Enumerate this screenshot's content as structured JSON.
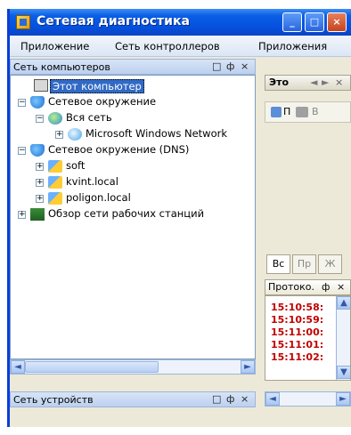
{
  "title": "Сетевая диагностика",
  "title_buttons": {
    "minimize": "_",
    "maximize": "□",
    "close": "×"
  },
  "menu": [
    "Приложение",
    "Сеть контроллеров",
    "Приложения"
  ],
  "left_panel": {
    "title": "Сеть компьютеров",
    "controls": [
      "□",
      "ф",
      "×"
    ],
    "tree": [
      {
        "label": "Этот компьютер",
        "icon": "computer-icon",
        "selected": true
      },
      {
        "label": "Сетевое окружение",
        "icon": "network-places-icon",
        "expanded": true
      },
      {
        "label": "Вся сеть",
        "icon": "globe-icon",
        "expanded": true
      },
      {
        "label": "Microsoft Windows Network",
        "icon": "windows-network-icon"
      },
      {
        "label": "Сетевое окружение (DNS)",
        "icon": "network-places-icon",
        "expanded": true
      },
      {
        "label": "soft",
        "icon": "domain-icon"
      },
      {
        "label": "kvint.local",
        "icon": "domain-icon"
      },
      {
        "label": "poligon.local",
        "icon": "domain-icon"
      },
      {
        "label": "Обзор сети рабочих станций",
        "icon": "workstations-icon"
      }
    ]
  },
  "devices_panel": {
    "title": "Сеть устройств",
    "controls": [
      "□",
      "ф",
      "×"
    ]
  },
  "right_panel": {
    "tab_title": "Это",
    "tab_nav": [
      "◄",
      "►",
      "×"
    ],
    "toolbar_labels": [
      "П",
      "В"
    ],
    "bottom_tabs": [
      "Вс",
      "Пр",
      "Ж"
    ],
    "log_title": "Протоко.",
    "log_controls": [
      "ф",
      "×"
    ],
    "log_lines": [
      "15:10:58:",
      "15:10:59:",
      "15:11:00:",
      "15:11:01:",
      "15:11:02:"
    ]
  },
  "colors": {
    "titlebar": "#0550dc",
    "selection": "#316ac5",
    "log_text": "#c00000"
  }
}
